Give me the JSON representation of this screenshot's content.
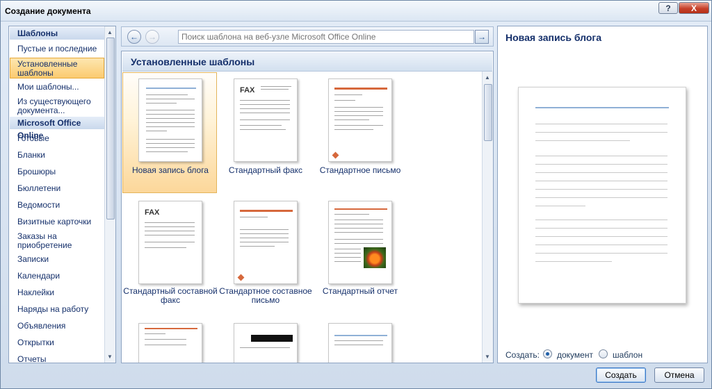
{
  "window": {
    "title": "Создание документа",
    "help": "?",
    "close": "X"
  },
  "nav": {
    "header_templates": "Шаблоны",
    "items_top": [
      {
        "label": "Пустые и последние"
      },
      {
        "label": "Установленные шаблоны"
      },
      {
        "label": "Мои шаблоны..."
      },
      {
        "label": "Из существующего документа..."
      }
    ],
    "header_online": "Microsoft Office Online",
    "items_online": [
      {
        "label": "Готовые"
      },
      {
        "label": "Бланки"
      },
      {
        "label": "Брошюры"
      },
      {
        "label": "Бюллетени"
      },
      {
        "label": "Ведомости"
      },
      {
        "label": "Визитные карточки"
      },
      {
        "label": "Заказы на приобретение"
      },
      {
        "label": "Записки"
      },
      {
        "label": "Календари"
      },
      {
        "label": "Наклейки"
      },
      {
        "label": "Наряды на работу"
      },
      {
        "label": "Объявления"
      },
      {
        "label": "Открытки"
      },
      {
        "label": "Отчеты"
      }
    ]
  },
  "search": {
    "placeholder": "Поиск шаблона на веб-узле Microsoft Office Online"
  },
  "gallery": {
    "title": "Установленные шаблоны",
    "templates": [
      {
        "label": "Новая запись блога"
      },
      {
        "label": "Стандартный факс"
      },
      {
        "label": "Стандартное письмо"
      },
      {
        "label": "Стандартный составной факс"
      },
      {
        "label": "Стандартное составное письмо"
      },
      {
        "label": "Стандартный отчет"
      }
    ],
    "fax_text": "FAX"
  },
  "preview": {
    "title": "Новая запись блога"
  },
  "create": {
    "label": "Создать:",
    "option_document": "документ",
    "option_template": "шаблон",
    "selected": "документ"
  },
  "buttons": {
    "create": "Создать",
    "cancel": "Отмена"
  },
  "colors": {
    "accent_orange": "#d6683c",
    "selection": "#fbcb70",
    "nav_text": "#15306b"
  }
}
